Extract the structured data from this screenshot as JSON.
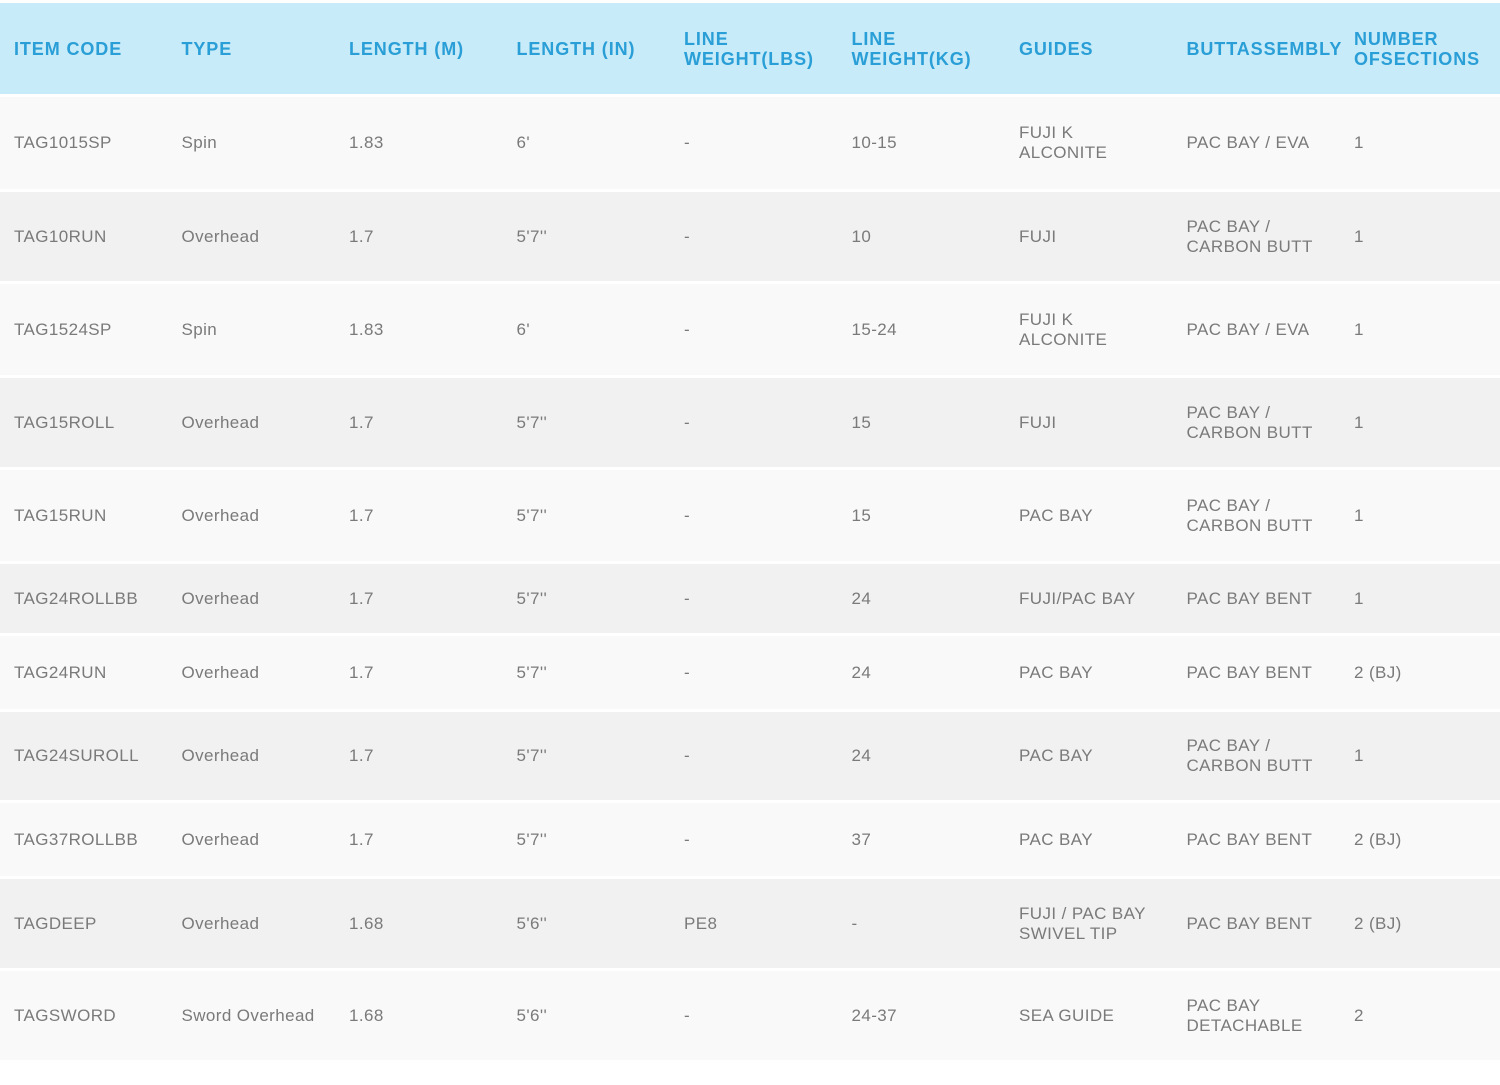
{
  "table": {
    "headers": [
      [
        "ITEM CODE"
      ],
      [
        "TYPE"
      ],
      [
        "LENGTH (M)"
      ],
      [
        "LENGTH (IN)"
      ],
      [
        "LINE WEIGHT",
        "(LBS)"
      ],
      [
        "LINE WEIGHT",
        "(KG)"
      ],
      [
        "GUIDES"
      ],
      [
        "BUTT",
        "ASSEMBLY"
      ],
      [
        "NUMBER OF",
        "SECTIONS"
      ]
    ],
    "rows": [
      [
        [
          "TAG1015SP"
        ],
        [
          "Spin"
        ],
        [
          "1.83"
        ],
        [
          "6'"
        ],
        [
          "-"
        ],
        [
          "10-15"
        ],
        [
          "FUJI K",
          "ALCONITE"
        ],
        [
          "PAC BAY / EVA"
        ],
        [
          "1"
        ]
      ],
      [
        [
          "TAG10RUN"
        ],
        [
          "Overhead"
        ],
        [
          "1.7"
        ],
        [
          "5'7''"
        ],
        [
          "-"
        ],
        [
          "10"
        ],
        [
          "FUJI"
        ],
        [
          "PAC BAY /",
          "CARBON BUTT"
        ],
        [
          "1"
        ]
      ],
      [
        [
          "TAG1524SP"
        ],
        [
          "Spin"
        ],
        [
          "1.83"
        ],
        [
          "6'"
        ],
        [
          "-"
        ],
        [
          "15-24"
        ],
        [
          "FUJI K",
          "ALCONITE"
        ],
        [
          "PAC BAY / EVA"
        ],
        [
          "1"
        ]
      ],
      [
        [
          "TAG15ROLL"
        ],
        [
          "Overhead"
        ],
        [
          "1.7"
        ],
        [
          "5'7''"
        ],
        [
          "-"
        ],
        [
          "15"
        ],
        [
          "FUJI"
        ],
        [
          "PAC BAY /",
          "CARBON BUTT"
        ],
        [
          "1"
        ]
      ],
      [
        [
          "TAG15RUN"
        ],
        [
          "Overhead"
        ],
        [
          "1.7"
        ],
        [
          "5'7''"
        ],
        [
          "-"
        ],
        [
          "15"
        ],
        [
          "PAC BAY"
        ],
        [
          "PAC BAY /",
          "CARBON BUTT"
        ],
        [
          "1"
        ]
      ],
      [
        [
          "TAG24ROLLBB"
        ],
        [
          "Overhead"
        ],
        [
          "1.7"
        ],
        [
          "5'7''"
        ],
        [
          "-"
        ],
        [
          "24"
        ],
        [
          "FUJI/PAC BAY"
        ],
        [
          "PAC BAY BENT"
        ],
        [
          "1"
        ]
      ],
      [
        [
          "TAG24RUN"
        ],
        [
          "Overhead"
        ],
        [
          "1.7"
        ],
        [
          "5'7''"
        ],
        [
          "-"
        ],
        [
          "24"
        ],
        [
          "PAC BAY"
        ],
        [
          "PAC BAY BENT"
        ],
        [
          "2 (BJ)"
        ]
      ],
      [
        [
          "TAG24SUROLL"
        ],
        [
          "Overhead"
        ],
        [
          "1.7"
        ],
        [
          "5'7''"
        ],
        [
          "-"
        ],
        [
          "24"
        ],
        [
          "PAC BAY"
        ],
        [
          "PAC BAY /",
          "CARBON BUTT"
        ],
        [
          "1"
        ]
      ],
      [
        [
          "TAG37ROLLBB"
        ],
        [
          "Overhead"
        ],
        [
          "1.7"
        ],
        [
          "5'7''"
        ],
        [
          "-"
        ],
        [
          "37"
        ],
        [
          "PAC BAY"
        ],
        [
          "PAC BAY BENT"
        ],
        [
          "2 (BJ)"
        ]
      ],
      [
        [
          "TAGDEEP"
        ],
        [
          "Overhead"
        ],
        [
          "1.68"
        ],
        [
          "5'6''"
        ],
        [
          "PE8"
        ],
        [
          "-"
        ],
        [
          "FUJI / PAC BAY",
          "SWIVEL TIP"
        ],
        [
          "PAC BAY BENT"
        ],
        [
          "2 (BJ)"
        ]
      ],
      [
        [
          "TAGSWORD"
        ],
        [
          "Sword Overhead"
        ],
        [
          "1.68"
        ],
        [
          "5'6''"
        ],
        [
          "-"
        ],
        [
          "24-37"
        ],
        [
          "SEA GUIDE"
        ],
        [
          "PAC BAY",
          "DETACHABLE"
        ],
        [
          "2"
        ]
      ]
    ]
  }
}
